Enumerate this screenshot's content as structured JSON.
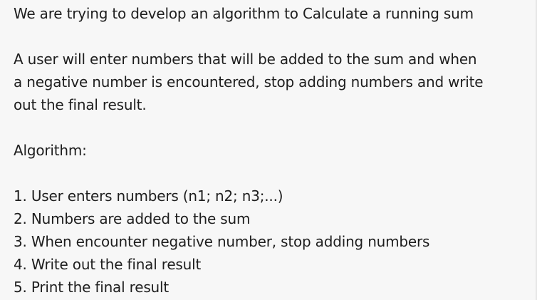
{
  "intro": "We are trying to develop an algorithm to Calculate a running sum",
  "description_lines": [
    "A user will enter numbers that will be added to the sum and when",
    "a negative number is encountered, stop adding numbers and write",
    "out the final result."
  ],
  "algorithm_heading": "Algorithm:",
  "steps": [
    "1. User enters numbers (n1; n2; n3;...)",
    "2. Numbers are added to the sum",
    "3. When encounter negative number, stop adding numbers",
    "4. Write out the final result",
    "5. Print the final result"
  ]
}
